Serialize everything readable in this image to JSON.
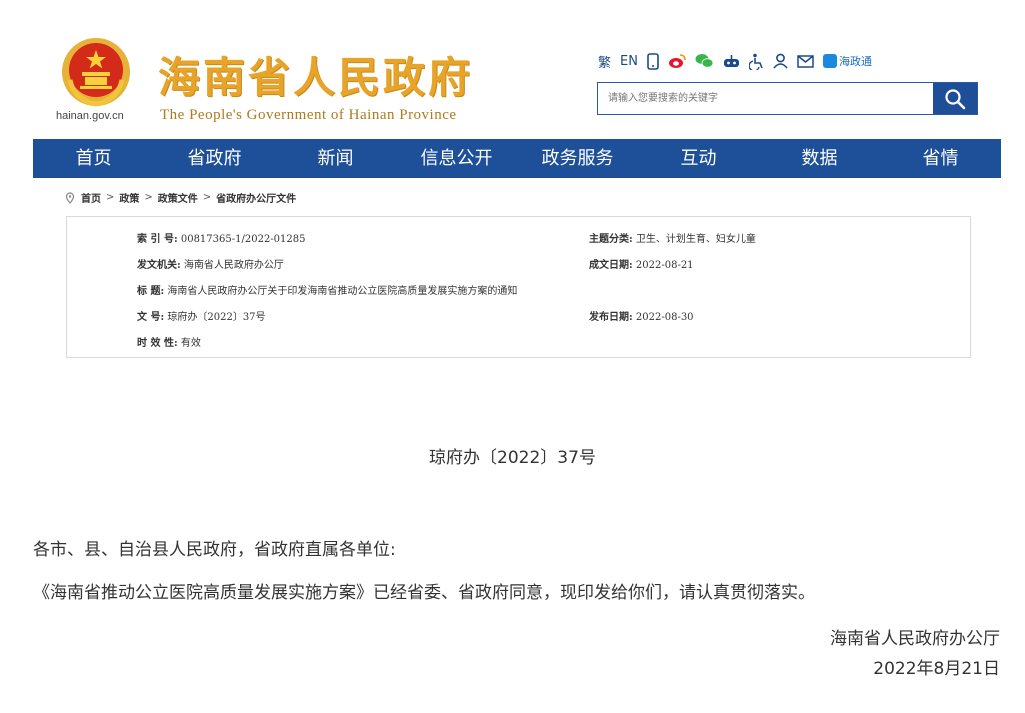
{
  "header": {
    "domain": "hainan.gov.cn",
    "title": "海南省人民政府",
    "subtitle": "The People's Government  of Hainan Province",
    "toolbar": {
      "traditional": "繁",
      "english": "EN",
      "app_label": "海政通"
    },
    "search_placeholder": "请输入您要搜索的关键字"
  },
  "nav": {
    "items": [
      "首页",
      "省政府",
      "新闻",
      "信息公开",
      "政务服务",
      "互动",
      "数据",
      "省情"
    ]
  },
  "breadcrumb": {
    "items": [
      "首页",
      "政策",
      "政策文件",
      "省政府办公厅文件"
    ],
    "separator": ">"
  },
  "meta": {
    "index_no_label": "索 引 号:",
    "index_no": "00817365-1/2022-01285",
    "category_label": "主题分类:",
    "category": "卫生、计划生育、妇女儿童",
    "issuer_label": "发文机关:",
    "issuer": "海南省人民政府办公厅",
    "date_written_label": "成文日期:",
    "date_written": "2022-08-21",
    "title_label": "标    题:",
    "title": "海南省人民政府办公厅关于印发海南省推动公立医院高质量发展实施方案的通知",
    "doc_no_label": "文    号:",
    "doc_no": "琼府办〔2022〕37号",
    "pub_date_label": "发布日期:",
    "pub_date": "2022-08-30",
    "validity_label": "时 效 性:",
    "validity": "有效"
  },
  "document": {
    "number": "琼府办〔2022〕37号",
    "salutation": "各市、县、自治县人民政府，省政府直属各单位:",
    "body": "《海南省推动公立医院高质量发展实施方案》已经省委、省政府同意，现印发给你们，请认真贯彻落实。",
    "signature": "海南省人民政府办公厅",
    "date": "2022年8月21日"
  },
  "colors": {
    "nav_bg": "#1e4f99",
    "title_gold": "#e8a428",
    "emblem_red": "#d42a1a"
  }
}
